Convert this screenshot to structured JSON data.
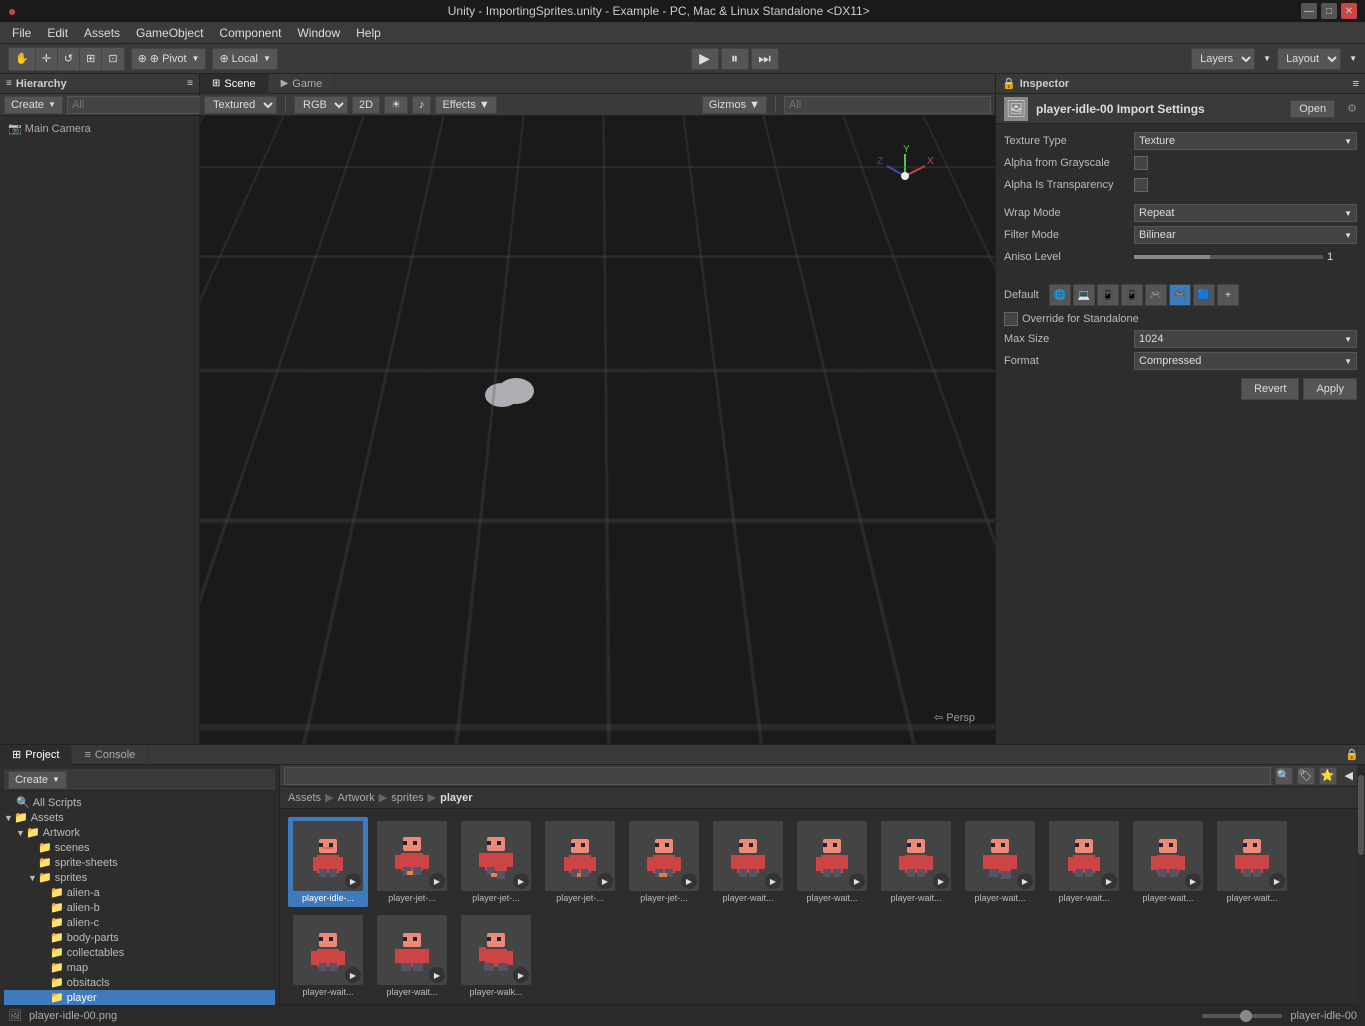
{
  "titlebar": {
    "title": "Unity - ImportingSprites.unity - Example - PC, Mac & Linux Standalone <DX11>",
    "unity_icon": "●",
    "min_btn": "—",
    "max_btn": "□",
    "close_btn": "✕"
  },
  "menubar": {
    "items": [
      "File",
      "Edit",
      "Assets",
      "GameObject",
      "Component",
      "Window",
      "Help"
    ]
  },
  "toolbar": {
    "pivot_label": "⊕ Pivot",
    "local_label": "⊕ Local",
    "play_btn": "▶",
    "pause_btn": "⏸",
    "step_btn": "⏭",
    "layers_label": "Layers",
    "layout_label": "Layout"
  },
  "hierarchy": {
    "panel_title": "Hierarchy",
    "create_label": "Create",
    "search_placeholder": "All",
    "items": [
      "Main Camera"
    ]
  },
  "scene": {
    "tabs": [
      "Scene",
      "Game"
    ],
    "active_tab": "Scene",
    "toolbar": {
      "draw_mode": "Textured",
      "color_mode": "RGB",
      "two_d_btn": "2D",
      "light_icon": "☀",
      "audio_icon": "♪",
      "effects_label": "Effects",
      "gizmos_label": "Gizmos",
      "search_placeholder": "All"
    },
    "persp_label": "⇦ Persp"
  },
  "inspector": {
    "panel_title": "Inspector",
    "asset_name": "player-idle-00 Import Settings",
    "open_btn": "Open",
    "asset_icon": "🖼",
    "settings": {
      "texture_type_label": "Texture Type",
      "texture_type_value": "Texture",
      "alpha_grayscale_label": "Alpha from Grayscale",
      "alpha_transparency_label": "Alpha Is Transparency",
      "wrap_mode_label": "Wrap Mode",
      "wrap_mode_value": "Repeat",
      "filter_mode_label": "Filter Mode",
      "filter_mode_value": "Bilinear",
      "aniso_level_label": "Aniso Level",
      "aniso_level_value": "1"
    },
    "platform": {
      "default_label": "Default",
      "icons": [
        "🌐",
        "💻",
        "📱",
        "📱",
        "🎮",
        "🎮",
        "🟦",
        "+"
      ]
    },
    "override_label": "Override for Standalone",
    "max_size_label": "Max Size",
    "max_size_value": "1024",
    "format_label": "Format",
    "format_value": "Compressed",
    "revert_btn": "Revert",
    "apply_btn": "Apply"
  },
  "bottom": {
    "tabs": [
      "Project",
      "Console"
    ],
    "active_tab": "Project",
    "toolbar": {
      "create_label": "Create",
      "search_placeholder": ""
    },
    "breadcrumb": [
      "Assets",
      "Artwork",
      "sprites",
      "player"
    ],
    "tree": {
      "items": [
        {
          "label": "All Scripts",
          "indent": 0,
          "icon": "🔍",
          "arrow": "",
          "type": "search"
        },
        {
          "label": "Assets",
          "indent": 0,
          "icon": "📁",
          "arrow": "▼",
          "type": "folder",
          "expanded": true
        },
        {
          "label": "Artwork",
          "indent": 1,
          "icon": "📁",
          "arrow": "▼",
          "type": "folder",
          "expanded": true
        },
        {
          "label": "scenes",
          "indent": 2,
          "icon": "📁",
          "arrow": "",
          "type": "folder"
        },
        {
          "label": "sprite-sheets",
          "indent": 2,
          "icon": "📁",
          "arrow": "",
          "type": "folder"
        },
        {
          "label": "sprites",
          "indent": 2,
          "icon": "📁",
          "arrow": "▼",
          "type": "folder",
          "expanded": true
        },
        {
          "label": "alien-a",
          "indent": 3,
          "icon": "📁",
          "arrow": "",
          "type": "folder"
        },
        {
          "label": "alien-b",
          "indent": 3,
          "icon": "📁",
          "arrow": "",
          "type": "folder"
        },
        {
          "label": "alien-c",
          "indent": 3,
          "icon": "📁",
          "arrow": "",
          "type": "folder"
        },
        {
          "label": "body-parts",
          "indent": 3,
          "icon": "📁",
          "arrow": "",
          "type": "folder"
        },
        {
          "label": "collectables",
          "indent": 3,
          "icon": "📁",
          "arrow": "",
          "type": "folder"
        },
        {
          "label": "map",
          "indent": 3,
          "icon": "📁",
          "arrow": "",
          "type": "folder"
        },
        {
          "label": "obsitacls",
          "indent": 3,
          "icon": "📁",
          "arrow": "",
          "type": "folder"
        },
        {
          "label": "player",
          "indent": 3,
          "icon": "📁",
          "arrow": "",
          "type": "folder",
          "selected": true
        }
      ]
    },
    "sprites": [
      {
        "name": "player-idle-...",
        "selected": true
      },
      {
        "name": "player-jet-...",
        "selected": false
      },
      {
        "name": "player-jet-...",
        "selected": false
      },
      {
        "name": "player-jet-...",
        "selected": false
      },
      {
        "name": "player-jet-...",
        "selected": false
      },
      {
        "name": "player-wait...",
        "selected": false
      },
      {
        "name": "player-wait...",
        "selected": false
      },
      {
        "name": "player-wait...",
        "selected": false
      },
      {
        "name": "player-wait...",
        "selected": false
      },
      {
        "name": "player-wait...",
        "selected": false
      },
      {
        "name": "player-wait...",
        "selected": false
      },
      {
        "name": "player-wait...",
        "selected": false
      },
      {
        "name": "player-wait...",
        "selected": false
      },
      {
        "name": "player-wait...",
        "selected": false
      },
      {
        "name": "player-walk...",
        "selected": false
      }
    ]
  },
  "statusbar": {
    "file_name": "player-idle-00.png",
    "asset_name": "player-idle-00"
  }
}
